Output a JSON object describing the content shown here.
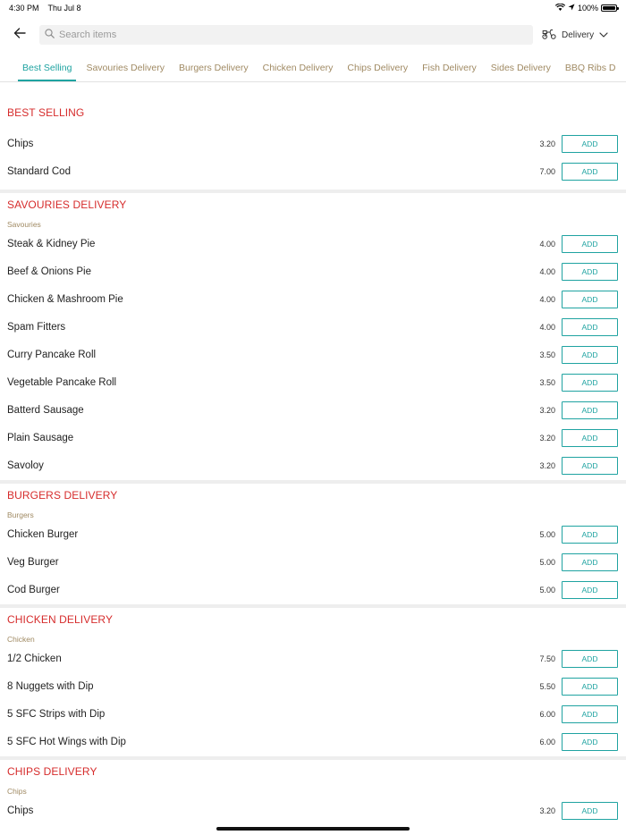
{
  "status_bar": {
    "time": "4:30 PM",
    "date": "Thu Jul 8",
    "battery": "100%",
    "battery_level": 1.0
  },
  "header": {
    "search_placeholder": "Search items",
    "delivery_label": "Delivery"
  },
  "tabs": [
    {
      "label": "Best Selling",
      "active": true
    },
    {
      "label": "Savouries Delivery"
    },
    {
      "label": "Burgers Delivery"
    },
    {
      "label": "Chicken Delivery"
    },
    {
      "label": "Chips Delivery"
    },
    {
      "label": "Fish Delivery"
    },
    {
      "label": "Sides Delivery"
    },
    {
      "label": "BBQ Ribs D"
    }
  ],
  "add_label": "ADD",
  "sections": {
    "best_selling": {
      "title": "BEST SELLING",
      "items": [
        {
          "name": "Chips",
          "price": "3.20"
        },
        {
          "name": "Standard Cod",
          "price": "7.00"
        }
      ]
    },
    "savouries": {
      "title": "SAVOURIES DELIVERY",
      "subcategory": "Savouries",
      "items": [
        {
          "name": "Steak & Kidney Pie",
          "price": "4.00"
        },
        {
          "name": "Beef & Onions Pie",
          "price": "4.00"
        },
        {
          "name": "Chicken & Mashroom Pie",
          "price": "4.00"
        },
        {
          "name": "Spam Fitters",
          "price": "4.00"
        },
        {
          "name": "Curry Pancake Roll",
          "price": "3.50"
        },
        {
          "name": "Vegetable Pancake Roll",
          "price": "3.50"
        },
        {
          "name": "Batterd Sausage",
          "price": "3.20"
        },
        {
          "name": "Plain Sausage",
          "price": "3.20"
        },
        {
          "name": "Savoloy",
          "price": "3.20"
        }
      ]
    },
    "burgers": {
      "title": "BURGERS DELIVERY",
      "subcategory": "Burgers",
      "items": [
        {
          "name": "Chicken Burger",
          "price": "5.00"
        },
        {
          "name": "Veg Burger",
          "price": "5.00"
        },
        {
          "name": "Cod Burger",
          "price": "5.00"
        }
      ]
    },
    "chicken": {
      "title": "CHICKEN DELIVERY",
      "subcategory": "Chicken",
      "items": [
        {
          "name": "1/2 Chicken",
          "price": "7.50"
        },
        {
          "name": "8 Nuggets with Dip",
          "price": "5.50"
        },
        {
          "name": "5 SFC Strips with Dip",
          "price": "6.00"
        },
        {
          "name": "5 SFC Hot Wings with Dip",
          "price": "6.00"
        }
      ]
    },
    "chips": {
      "title": "CHIPS DELIVERY",
      "subcategory": "Chips",
      "items": [
        {
          "name": "Chips",
          "price": "3.20"
        }
      ]
    }
  }
}
